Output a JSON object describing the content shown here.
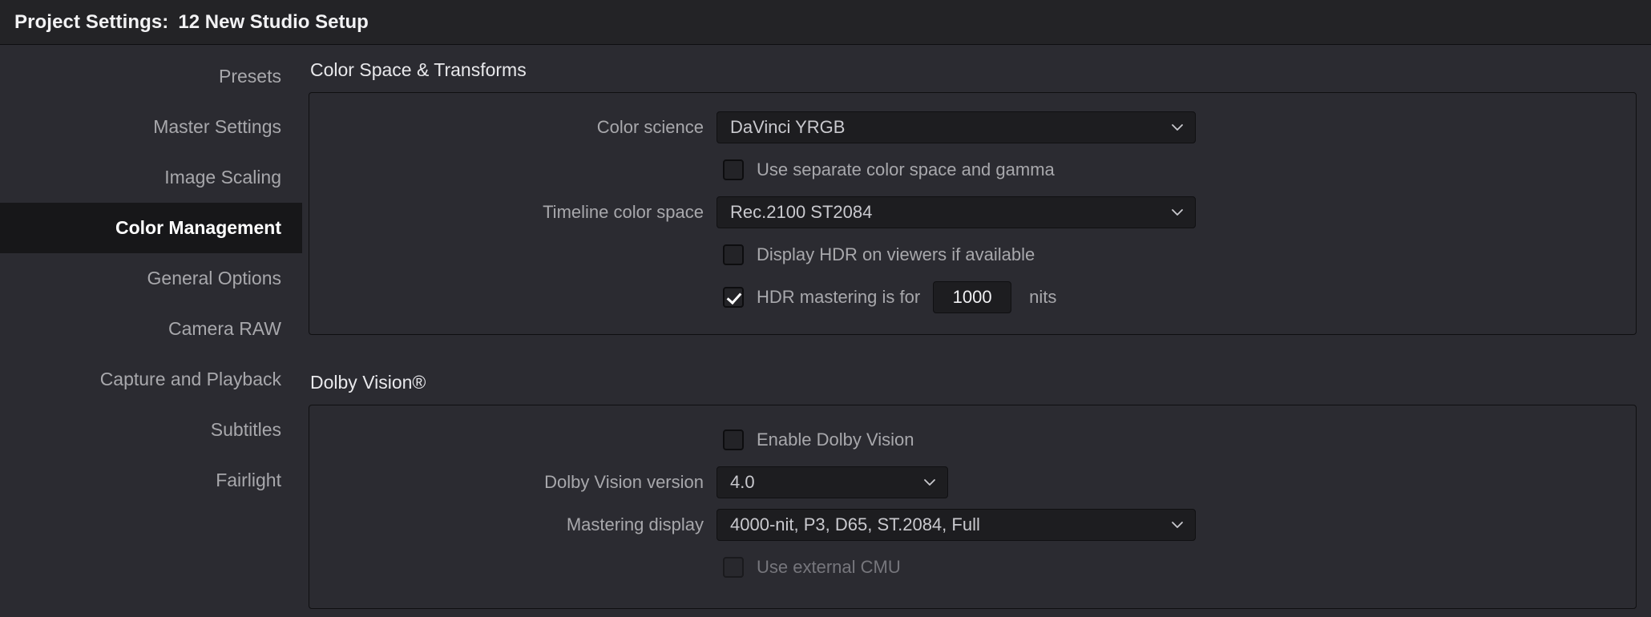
{
  "window": {
    "title_prefix": "Project Settings:",
    "project_name": "12 New Studio Setup"
  },
  "sidebar": {
    "items": [
      {
        "label": "Presets",
        "selected": false
      },
      {
        "label": "Master Settings",
        "selected": false
      },
      {
        "label": "Image Scaling",
        "selected": false
      },
      {
        "label": "Color Management",
        "selected": true
      },
      {
        "label": "General Options",
        "selected": false
      },
      {
        "label": "Camera RAW",
        "selected": false
      },
      {
        "label": "Capture and Playback",
        "selected": false
      },
      {
        "label": "Subtitles",
        "selected": false
      },
      {
        "label": "Fairlight",
        "selected": false
      }
    ]
  },
  "color_space_transforms": {
    "section_title": "Color Space & Transforms",
    "color_science": {
      "label": "Color science",
      "value": "DaVinci YRGB",
      "icon": "chevron-down-icon"
    },
    "use_separate_color_space": {
      "label": "Use separate color space and gamma",
      "checked": false
    },
    "timeline_color_space": {
      "label": "Timeline color space",
      "value": "Rec.2100 ST2084",
      "icon": "chevron-down-icon"
    },
    "display_hdr_on_viewers": {
      "label": "Display HDR on viewers if available",
      "checked": false
    },
    "hdr_mastering": {
      "label": "HDR mastering is for",
      "checked": true,
      "nits_value": "1000",
      "unit": "nits"
    }
  },
  "dolby_vision": {
    "section_title": "Dolby Vision®",
    "enable": {
      "label": "Enable Dolby Vision",
      "checked": false
    },
    "version": {
      "label": "Dolby Vision version",
      "value": "4.0",
      "icon": "chevron-down-icon"
    },
    "mastering_display": {
      "label": "Mastering display",
      "value": "4000-nit, P3, D65, ST.2084, Full",
      "icon": "chevron-down-icon"
    },
    "use_external_cmu": {
      "label": "Use external CMU",
      "checked": false,
      "disabled": true
    }
  },
  "colors": {
    "window_bg": "#2b2b31",
    "titlebar_bg": "#232326",
    "selected_nav_bg": "#171719",
    "field_bg": "#1d1d20",
    "label_text": "#a8a8ac",
    "value_text": "#c9c9ce",
    "title_text": "#f2f2f4"
  }
}
